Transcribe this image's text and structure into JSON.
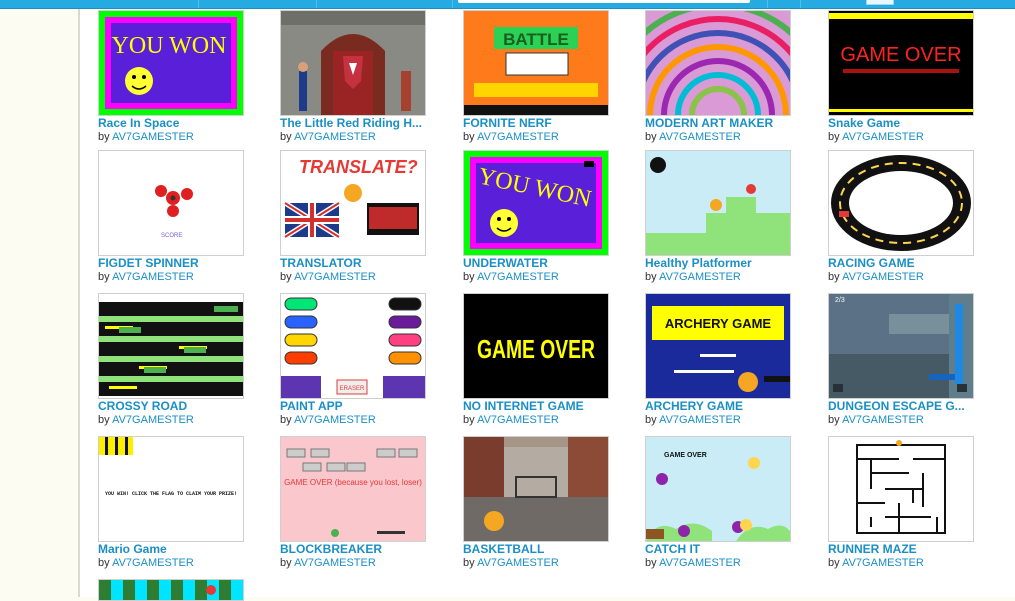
{
  "author_prefix": "by",
  "projects": [
    {
      "title": "Race In Space",
      "author": "AV7GAMESTER",
      "thumb_text": "YOU WON"
    },
    {
      "title": "The Little Red Riding H...",
      "author": "AV7GAMESTER",
      "thumb_text": ""
    },
    {
      "title": "FORNITE NERF",
      "author": "AV7GAMESTER",
      "thumb_text": "BATTLE"
    },
    {
      "title": "MODERN ART MAKER",
      "author": "AV7GAMESTER",
      "thumb_text": ""
    },
    {
      "title": "Snake Game",
      "author": "AV7GAMESTER",
      "thumb_text": "GAME OVER"
    },
    {
      "title": "FIGDET SPINNER",
      "author": "AV7GAMESTER",
      "thumb_text": "SCORE"
    },
    {
      "title": "TRANSLATOR",
      "author": "AV7GAMESTER",
      "thumb_text": "TRANSLATE?"
    },
    {
      "title": "UNDERWATER",
      "author": "AV7GAMESTER",
      "thumb_text": "YOU WON"
    },
    {
      "title": "Healthy Platformer",
      "author": "AV7GAMESTER",
      "thumb_text": ""
    },
    {
      "title": "RACING GAME",
      "author": "AV7GAMESTER",
      "thumb_text": ""
    },
    {
      "title": "CROSSY ROAD",
      "author": "AV7GAMESTER",
      "thumb_text": ""
    },
    {
      "title": "PAINT APP",
      "author": "AV7GAMESTER",
      "thumb_text": "ERASER"
    },
    {
      "title": "NO INTERNET GAME",
      "author": "AV7GAMESTER",
      "thumb_text": "GAME OVER"
    },
    {
      "title": "ARCHERY GAME",
      "author": "AV7GAMESTER",
      "thumb_text": "ARCHERY GAME"
    },
    {
      "title": "DUNGEON ESCAPE G...",
      "author": "AV7GAMESTER",
      "thumb_text": "2/3"
    },
    {
      "title": "Mario Game",
      "author": "AV7GAMESTER",
      "thumb_text": "YOU WIN! CLICK THE FLAG TO CLAIM YOUR PRIZE!"
    },
    {
      "title": "BLOCKBREAKER",
      "author": "AV7GAMESTER",
      "thumb_text": "GAME OVER (because you lost, loser)"
    },
    {
      "title": "BASKETBALL",
      "author": "AV7GAMESTER",
      "thumb_text": ""
    },
    {
      "title": "CATCH IT",
      "author": "AV7GAMESTER",
      "thumb_text": "GAME OVER"
    },
    {
      "title": "RUNNER MAZE",
      "author": "AV7GAMESTER",
      "thumb_text": ""
    }
  ],
  "colors": {
    "link": "#1a8fc6",
    "topbar": "#25aae1"
  }
}
